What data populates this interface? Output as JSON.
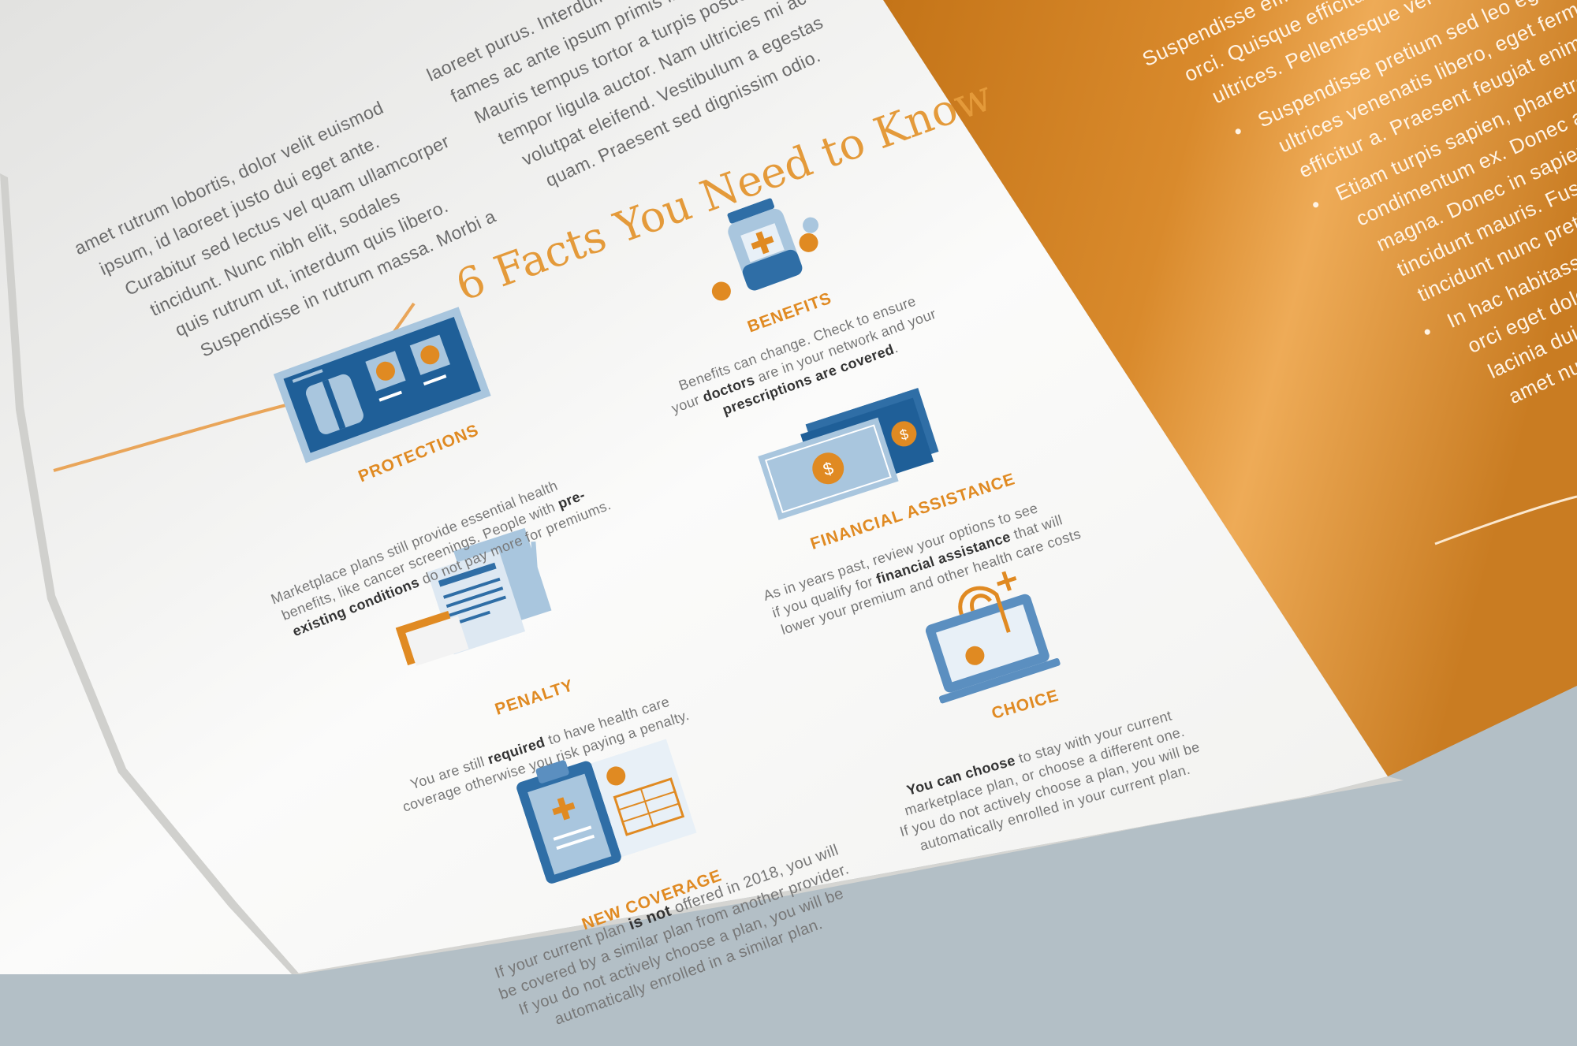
{
  "left_column_text": [
    "amet rutrum lobortis, dolor velit euismod",
    "ipsum, id laoreet justo dui eget ante.",
    "Curabitur sed lectus vel quam ullamcorper",
    "tincidunt. Nunc nibh elit, sodales",
    "quis rutrum ut, interdum quis libero.",
    "Suspendisse in rutrum massa. Morbi a"
  ],
  "right_column_text": [
    "laoreet purus. Interdum et malesuada",
    "fames ac ante ipsum primis in faucibus.",
    "Mauris tempus tortor a turpis posuere, id",
    "tempor ligula auctor. Nam ultricies mi ac",
    "volutpat eleifend. Vestibulum a egestas",
    "quam. Praesent sed dignissim odio."
  ],
  "heading": "6 Facts You Need to Know",
  "facts": [
    {
      "title": "PROTECTIONS",
      "desc_lines": [
        {
          "pre": "Marketplace plans still provide essential health",
          "bold": "",
          "post": ""
        },
        {
          "pre": "benefits, like cancer screenings. People with ",
          "bold": "pre-",
          "post": ""
        },
        {
          "pre": "",
          "bold": "existing conditions",
          "post": " do not pay more for premiums."
        }
      ],
      "icon": "xray-icon"
    },
    {
      "title": "BENEFITS",
      "desc_lines": [
        {
          "pre": "Benefits can change. Check to ensure",
          "bold": "",
          "post": ""
        },
        {
          "pre": "your ",
          "bold": "doctors",
          "post": " are in your network and your"
        },
        {
          "pre": "",
          "bold": "prescriptions are covered",
          "post": "."
        }
      ],
      "icon": "pill-bottle-icon"
    },
    {
      "title": "FINANCIAL ASSISTANCE",
      "desc_lines": [
        {
          "pre": "As in years past, review your options to see",
          "bold": "",
          "post": ""
        },
        {
          "pre": "if you qualify for ",
          "bold": "financial assistance",
          "post": " that will"
        },
        {
          "pre": "lower your premium and other health care costs",
          "bold": "",
          "post": ""
        }
      ],
      "icon": "money-icon"
    },
    {
      "title": "PENALTY",
      "desc_lines": [
        {
          "pre": "You are still ",
          "bold": "required",
          "post": " to have health care"
        },
        {
          "pre": "coverage otherwise you risk paying a penalty.",
          "bold": "",
          "post": ""
        }
      ],
      "icon": "documents-icon"
    },
    {
      "title": "CHOICE",
      "desc_lines": [
        {
          "pre": "",
          "bold": "You can choose",
          "post": " to stay with your current"
        },
        {
          "pre": "marketplace plan, or choose a different one.",
          "bold": "",
          "post": ""
        },
        {
          "pre": "If you do not actively choose a plan, you will be",
          "bold": "",
          "post": ""
        },
        {
          "pre": "automatically enrolled in your current plan.",
          "bold": "",
          "post": ""
        }
      ],
      "icon": "laptop-stethoscope-icon"
    },
    {
      "title": "NEW COVERAGE",
      "desc_lines": [
        {
          "pre": "If your current plan ",
          "bold": "is not",
          "post": " offered in 2018, you will"
        },
        {
          "pre": "be covered by a similar plan from another provider.",
          "bold": "",
          "post": ""
        },
        {
          "pre": "If you do not actively choose a plan, you will be",
          "bold": "",
          "post": ""
        },
        {
          "pre": "automatically enrolled in a similar plan.",
          "bold": "",
          "post": ""
        }
      ],
      "icon": "clipboard-icon"
    }
  ],
  "right_page": {
    "lines_top": [
      "Suspendisse efficitur, dolor ut",
      "orci. Quisque efficitur vel ultrices",
      "ultrices. Pellentesque vel ullamcorper"
    ],
    "bullets": [
      [
        "Suspendisse pretium sed leo eget fermentum.",
        "ultrices venenatis libero, eget fermentum",
        "efficitur a. Praesent feugiat enim"
      ],
      [
        "Etiam turpis sapien, pharetra sed",
        "condimentum ex. Donec ac viverra",
        "magna. Donec in sapien rutrum,",
        "tincidunt mauris. Fusce fermentum",
        "tincidunt nunc pretium"
      ],
      [
        "In hac habitasse platea dictumst.",
        "orci eget dolor molestie",
        "lacinia dui odio",
        "amet nunc tristique"
      ]
    ],
    "bullet_char": "•"
  },
  "colors": {
    "orange": "#e08a22",
    "blue": "#2f6ea6",
    "light_blue": "#a9c6de",
    "page_orange": "#d9872a",
    "background": "#b3bfc6"
  }
}
